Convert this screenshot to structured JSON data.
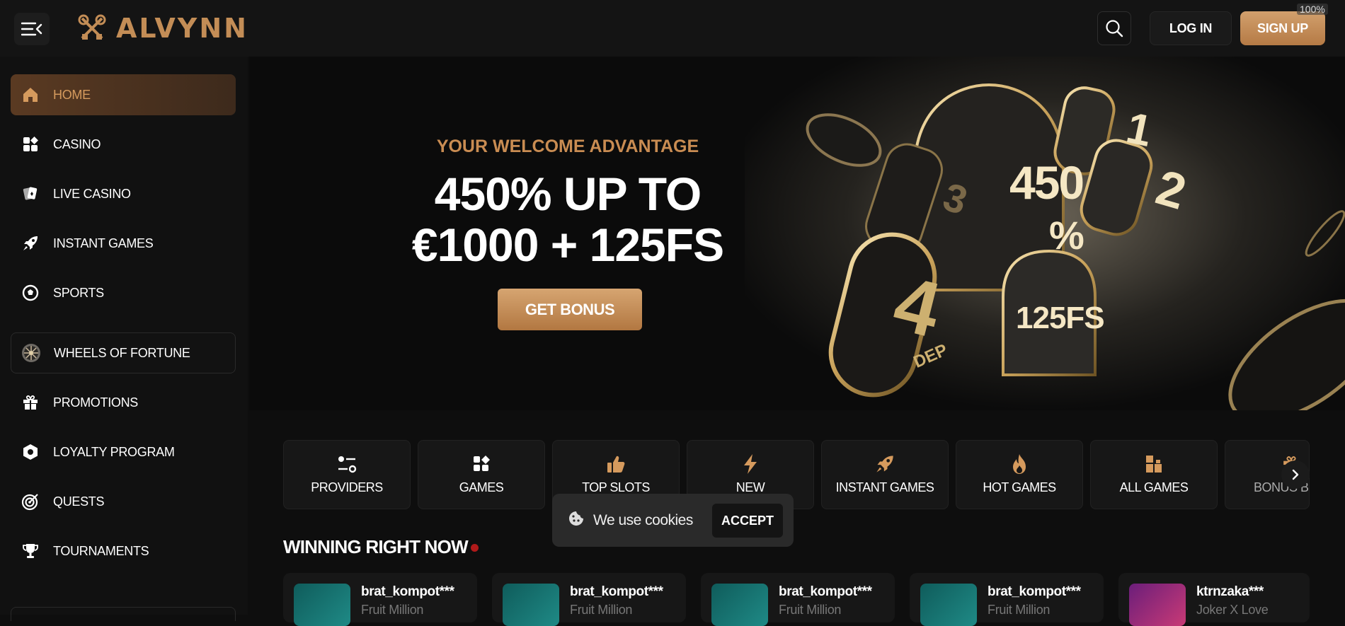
{
  "header": {
    "brand": "ALVYNN",
    "login_label": "LOG IN",
    "signup_label": "SIGN UP",
    "zoom": "100%"
  },
  "sidebar": {
    "items": [
      {
        "label": "HOME",
        "icon": "home-icon"
      },
      {
        "label": "CASINO",
        "icon": "casino-icon"
      },
      {
        "label": "LIVE CASINO",
        "icon": "cards-icon"
      },
      {
        "label": "INSTANT GAMES",
        "icon": "rocket-icon"
      },
      {
        "label": "SPORTS",
        "icon": "soccer-ball-icon"
      },
      {
        "label": "WHEELS OF FORTUNE",
        "icon": "wheel-icon"
      },
      {
        "label": "PROMOTIONS",
        "icon": "gift-icon"
      },
      {
        "label": "LOYALTY PROGRAM",
        "icon": "hexagon-icon"
      },
      {
        "label": "QUESTS",
        "icon": "target-icon"
      },
      {
        "label": "TOURNAMENTS",
        "icon": "trophy-icon"
      }
    ]
  },
  "hero": {
    "subtitle": "YOUR WELCOME ADVANTAGE",
    "title_line1": "450% UP TO",
    "title_line2": "€1000 + 125FS",
    "button": "GET BONUS",
    "art_percent": "450",
    "art_pct_sign": "%",
    "art_fs": "125FS",
    "art_dep_num": "4",
    "art_dep": "DEP",
    "art_n1": "1",
    "art_n2": "2",
    "art_n3": "3"
  },
  "categories": [
    {
      "label": "PROVIDERS",
      "icon": "sliders-icon"
    },
    {
      "label": "GAMES",
      "icon": "grid-icon"
    },
    {
      "label": "TOP SLOTS",
      "icon": "thumbs-up-icon"
    },
    {
      "label": "NEW",
      "icon": "lightning-icon"
    },
    {
      "label": "INSTANT GAMES",
      "icon": "rocket-icon"
    },
    {
      "label": "HOT GAMES",
      "icon": "fire-icon"
    },
    {
      "label": "ALL GAMES",
      "icon": "blocks-icon"
    },
    {
      "label": "BONUS B",
      "icon": "gift-icon"
    }
  ],
  "cookie": {
    "text": "We use cookies",
    "accept": "ACCEPT"
  },
  "winners": {
    "title": "WINNING RIGHT NOW",
    "items": [
      {
        "name": "brat_kompot***",
        "game": "Fruit Million"
      },
      {
        "name": "brat_kompot***",
        "game": "Fruit Million"
      },
      {
        "name": "brat_kompot***",
        "game": "Fruit Million"
      },
      {
        "name": "brat_kompot***",
        "game": "Fruit Million"
      },
      {
        "name": "ktrnzaka***",
        "game": "Joker X Love"
      }
    ]
  },
  "colors": {
    "accent": "#c98c52",
    "background": "#0e0e0e",
    "sidebar_active": "#5a3a22"
  }
}
